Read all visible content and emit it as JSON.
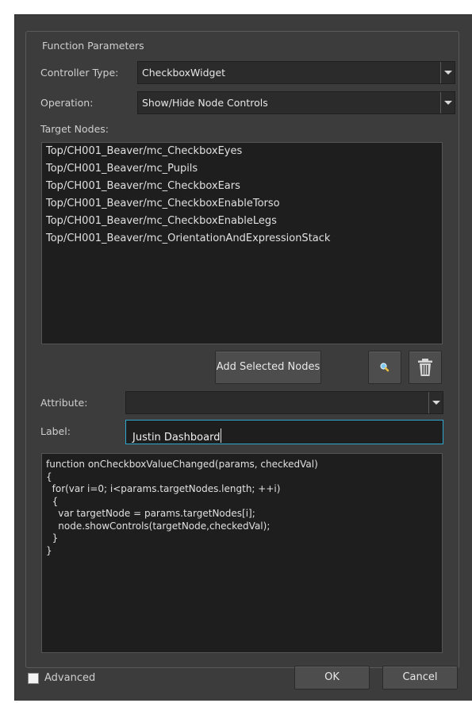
{
  "group": {
    "title": "Function Parameters"
  },
  "controller_type": {
    "label": "Controller Type:",
    "value": "CheckboxWidget"
  },
  "operation": {
    "label": "Operation:",
    "value": "Show/Hide Node Controls"
  },
  "target_nodes": {
    "label": "Target Nodes:",
    "items": [
      "Top/CH001_Beaver/mc_CheckboxEyes",
      "Top/CH001_Beaver/mc_Pupils",
      "Top/CH001_Beaver/mc_CheckboxEars",
      "Top/CH001_Beaver/mc_CheckboxEnableTorso",
      "Top/CH001_Beaver/mc_CheckboxEnableLegs",
      "Top/CH001_Beaver/mc_OrientationAndExpressionStack"
    ],
    "add_button": "Add Selected Nodes",
    "locate_icon": "magnifier-icon",
    "delete_icon": "trash-icon"
  },
  "attribute": {
    "label": "Attribute:",
    "value": ""
  },
  "label_field": {
    "label": "Label:",
    "value": "Justin Dashboard"
  },
  "code": {
    "lines": [
      "function onCheckboxValueChanged(params, checkedVal)",
      "{",
      "  for(var i=0; i<params.targetNodes.length; ++i)",
      "  {",
      "    var targetNode = params.targetNodes[i];",
      "    node.showControls(targetNode,checkedVal);",
      "  }",
      "}"
    ]
  },
  "footer": {
    "advanced_label": "Advanced",
    "advanced_checked": false,
    "ok_label": "OK",
    "cancel_label": "Cancel"
  },
  "colors": {
    "panel": "#3c3c3c",
    "field": "#1e1e1e",
    "focus_border": "#2fa6d0",
    "button": "#4d4d4d"
  }
}
